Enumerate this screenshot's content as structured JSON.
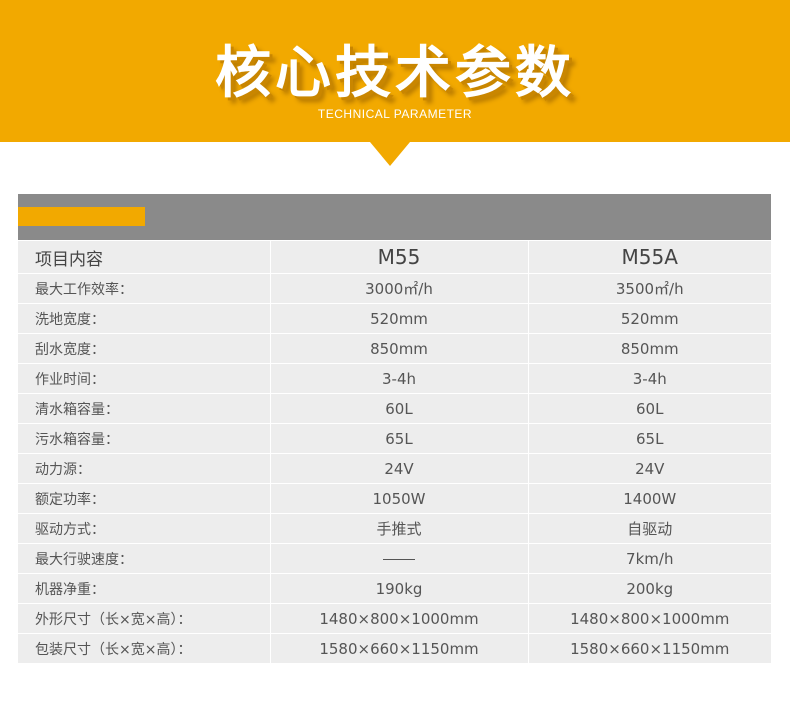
{
  "banner": {
    "title": "核心技术参数",
    "subtitle": "TECHNICAL PARAMETER"
  },
  "table": {
    "header": {
      "label": "项目内容",
      "m55": "M55",
      "m55a": "M55A"
    },
    "rows": [
      {
        "label": "最大工作效率：",
        "m55": "3000㎡/h",
        "m55a": "3500㎡/h"
      },
      {
        "label": "洗地宽度：",
        "m55": "520mm",
        "m55a": "520mm"
      },
      {
        "label": "刮水宽度：",
        "m55": "850mm",
        "m55a": "850mm"
      },
      {
        "label": "作业时间：",
        "m55": "3-4h",
        "m55a": "3-4h"
      },
      {
        "label": "清水箱容量：",
        "m55": "60L",
        "m55a": "60L"
      },
      {
        "label": "污水箱容量：",
        "m55": "65L",
        "m55a": "65L"
      },
      {
        "label": "动力源：",
        "m55": "24V",
        "m55a": "24V"
      },
      {
        "label": "额定功率：",
        "m55": "1050W",
        "m55a": "1400W"
      },
      {
        "label": "驱动方式：",
        "m55": "手推式",
        "m55a": "自驱动"
      },
      {
        "label": "最大行驶速度：",
        "m55": "",
        "m55a": "7km/h"
      },
      {
        "label": "机器净重：",
        "m55": "190kg",
        "m55a": "200kg"
      },
      {
        "label": "外形尺寸（长×宽×高）：",
        "m55": "1480×800×1000mm",
        "m55a": "1480×800×1000mm"
      },
      {
        "label": "包装尺寸（长×宽×高）：",
        "m55": "1580×660×1150mm",
        "m55a": "1580×660×1150mm"
      }
    ]
  },
  "colors": {
    "accent": "#f2a900",
    "header_bar": "#8a8a8a",
    "row_bg": "#ededed"
  }
}
